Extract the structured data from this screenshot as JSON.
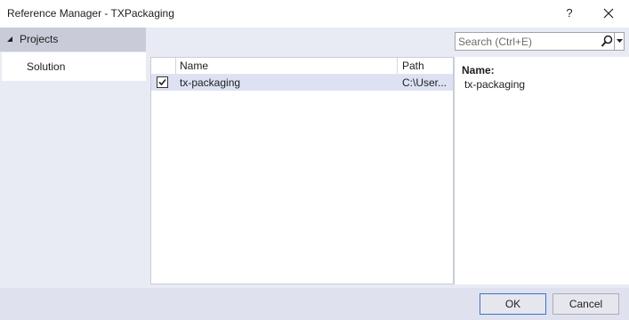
{
  "window": {
    "title": "Reference Manager - TXPackaging",
    "help_label": "?"
  },
  "sidebar": {
    "items": [
      {
        "label": "Projects",
        "expanded": true
      },
      {
        "label": "Solution",
        "selected": true
      }
    ]
  },
  "search": {
    "placeholder": "Search (Ctrl+E)",
    "value": ""
  },
  "table": {
    "columns": [
      "",
      "Name",
      "Path"
    ],
    "rows": [
      {
        "checked": true,
        "name": "tx-packaging",
        "path": "C:\\User..."
      }
    ]
  },
  "details": {
    "name_label": "Name:",
    "name_value": "tx-packaging"
  },
  "footer": {
    "ok_label": "OK",
    "cancel_label": "Cancel"
  },
  "colors": {
    "accent": "#3a73c7",
    "selected_row": "#dde1f3",
    "panel_bg": "#e9ebf4"
  }
}
